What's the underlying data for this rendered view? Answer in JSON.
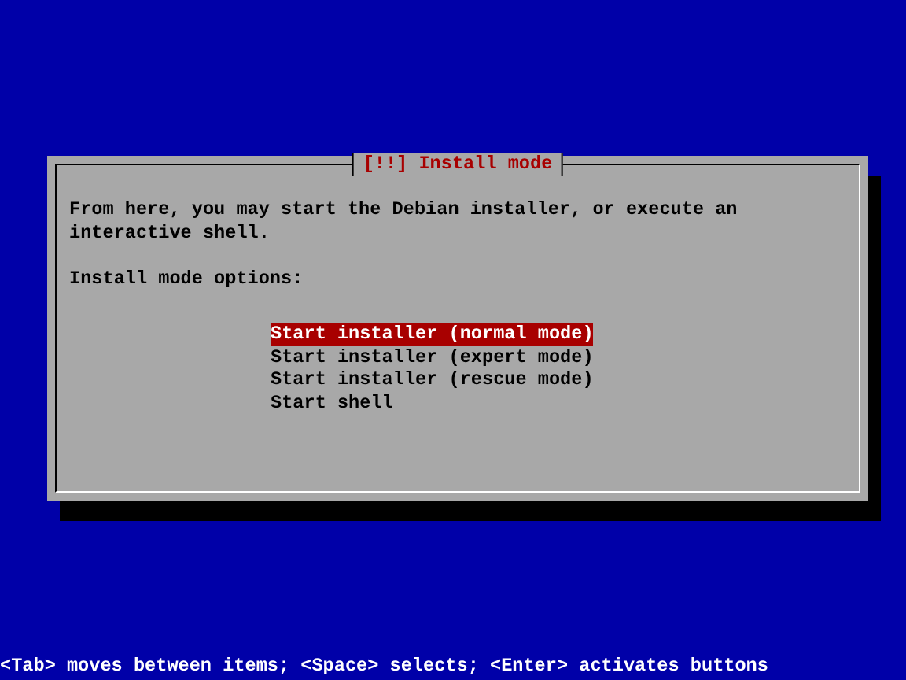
{
  "dialog": {
    "title": "[!!] Install mode",
    "message": "From here, you may start the Debian installer, or execute an interactive shell.",
    "prompt": "Install mode options:",
    "options": [
      {
        "label": "Start installer (normal mode)",
        "selected": true
      },
      {
        "label": "Start installer (expert mode)",
        "selected": false
      },
      {
        "label": "Start installer (rescue mode)",
        "selected": false
      },
      {
        "label": "Start shell",
        "selected": false
      }
    ]
  },
  "status_bar": "<Tab> moves between items; <Space> selects; <Enter> activates buttons"
}
